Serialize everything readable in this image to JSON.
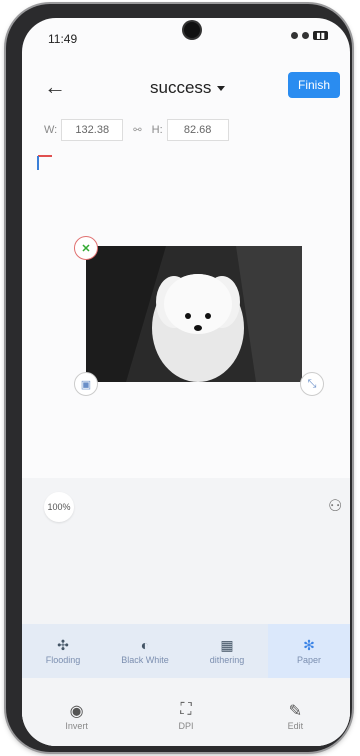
{
  "status": {
    "time": "11:49"
  },
  "header": {
    "title": "success",
    "finish_label": "Finish"
  },
  "dimensions": {
    "w_label": "W:",
    "w_value": "132.38",
    "h_label": "H:",
    "h_value": "82.68"
  },
  "canvas": {
    "zoom_label": "100%"
  },
  "modes": [
    {
      "label": "Flooding",
      "icon": "flooding-icon"
    },
    {
      "label": "Black White",
      "icon": "contrast-icon"
    },
    {
      "label": "dithering",
      "icon": "dithering-icon"
    },
    {
      "label": "Paper",
      "icon": "paper-icon"
    }
  ],
  "active_mode": "Paper",
  "tools": [
    {
      "label": "Invert",
      "icon": "invert-icon"
    },
    {
      "label": "DPI",
      "icon": "dpi-icon"
    },
    {
      "label": "Edit",
      "icon": "edit-icon"
    }
  ],
  "colors": {
    "accent": "#2a8cf0",
    "active_mode_bg": "#dbe8fb"
  }
}
